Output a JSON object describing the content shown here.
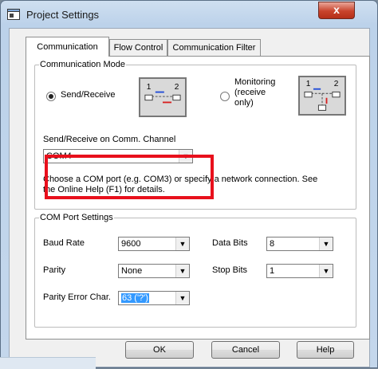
{
  "window": {
    "title": "Project Settings",
    "close_glyph": "x"
  },
  "tabs": [
    {
      "label": "Communication",
      "active": true
    },
    {
      "label": "Flow Control",
      "active": false
    },
    {
      "label": "Communication Filter",
      "active": false
    }
  ],
  "comm_mode": {
    "legend": "Communication Mode",
    "send_receive_label": "Send/Receive",
    "monitoring_label_1": "Monitoring",
    "monitoring_label_2": "(receive",
    "monitoring_label_3": "only)",
    "selected": "Send/Receive",
    "diagram_num_1": "1",
    "diagram_num_2": "2"
  },
  "channel": {
    "label": "Send/Receive on Comm. Channel",
    "value": "COM4",
    "help_line_1": "Choose a COM port (e.g. COM3) or specify a network connection. See",
    "help_line_2": "the Online Help (F1) for details."
  },
  "port_settings": {
    "legend": "COM Port Settings",
    "baud_label": "Baud Rate",
    "baud_value": "9600",
    "databits_label": "Data Bits",
    "databits_value": "8",
    "parity_label": "Parity",
    "parity_value": "None",
    "stopbits_label": "Stop Bits",
    "stopbits_value": "1",
    "parity_error_label": "Parity Error Char.",
    "parity_error_value": "63 ('?')"
  },
  "buttons": {
    "ok": "OK",
    "cancel": "Cancel",
    "help": "Help"
  },
  "colors": {
    "highlight": "#e8101c",
    "selection": "#3399ff",
    "close": "#c8432c"
  }
}
